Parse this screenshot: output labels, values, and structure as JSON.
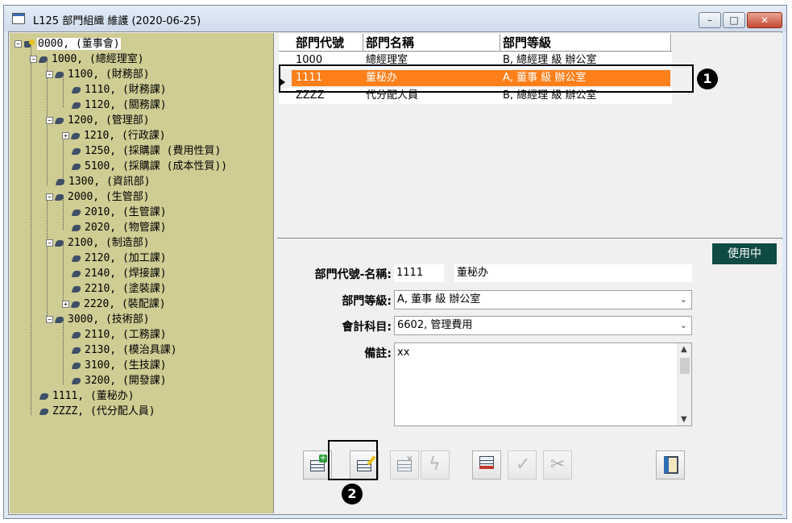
{
  "window": {
    "title": "L125 部門組織 維護 (2020-06-25)",
    "min_label": "–",
    "max_label": "□",
    "close_label": "✕"
  },
  "tree": {
    "root": "0000, (董事會)",
    "nodes": [
      "1000, (總經理室)",
      "1100, (財務部)",
      "1110, (財務課)",
      "1120, (關務課)",
      "1200, (管理部)",
      "1210, (行政課)",
      "1250, (採購課 (費用性質)",
      "5100, (採購課 (成本性質))",
      "1300, (資訊部)",
      "2000, (生管部)",
      "2010, (生管課)",
      "2020, (物管課)",
      "2100, (制造部)",
      "2120, (加工課)",
      "2140, (焊接課)",
      "2210, (塗裝課)",
      "2220, (裝配課)",
      "3000, (技術部)",
      "2110, (工務課)",
      "2130, (模治具課)",
      "3100, (生技課)",
      "3200, (開發課)",
      "1111, (董秘办)",
      "ZZZZ, (代分配人員)"
    ]
  },
  "grid": {
    "columns": [
      "部門代號",
      "部門名稱",
      "部門等級"
    ],
    "rows": [
      {
        "code": "1000",
        "name": "總經理室",
        "level": "B, 總經理 級 辦公室"
      },
      {
        "code": "1111",
        "name": "董秘办",
        "level": "A, 董事 級 辦公室"
      },
      {
        "code": "ZZZZ",
        "name": "代分配人員",
        "level": "B, 總經理 級 辦公室"
      }
    ]
  },
  "detail": {
    "status": "使用中",
    "code_name_label": "部門代號-名稱:",
    "code_value": "1111",
    "name_value": "董秘办",
    "level_label": "部門等級:",
    "level_value": "A, 董事 級 辦公室",
    "account_label": "會計科目:",
    "account_value": "6602, 管理費用",
    "memo_label": "備註:",
    "memo_value": "xx",
    "dropdown_glyph": "⌄"
  },
  "markers": {
    "one": "1",
    "two": "2"
  },
  "colors": {
    "selected_row": "#ff7f1a",
    "status_badge": "#0f4a45",
    "tree_bg": "#cfcc94"
  }
}
